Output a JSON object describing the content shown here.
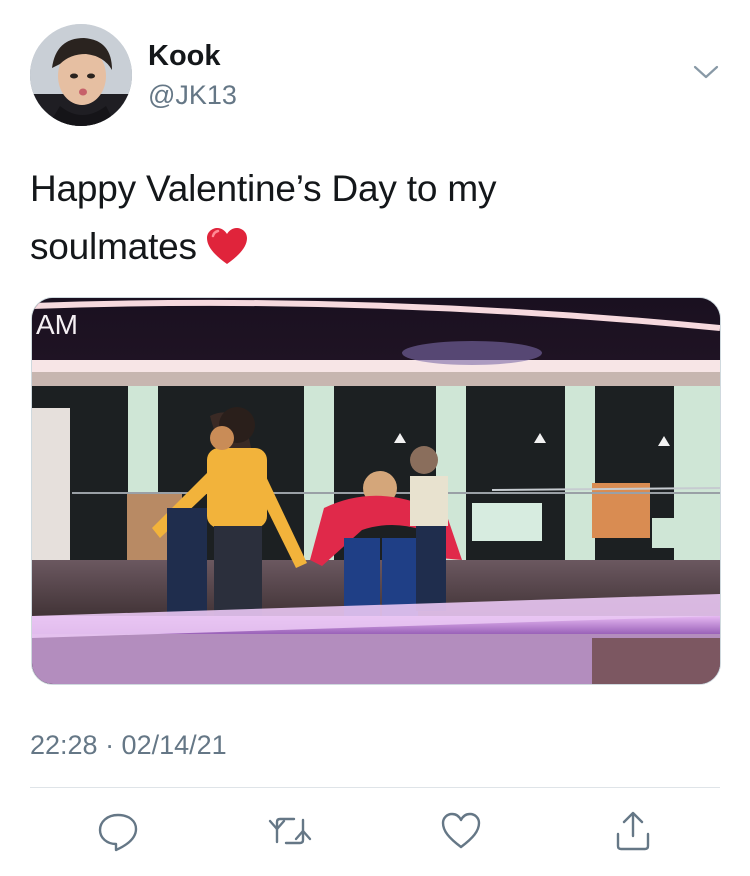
{
  "author": {
    "display_name": "Kook",
    "handle": "@JK13",
    "avatar_icon": "profile-photo"
  },
  "tweet": {
    "text": "Happy Valentine’s Day to my soulmates",
    "emoji": "red-heart",
    "media_overlay_text": "AM",
    "timestamp": "22:28 · 02/14/21"
  },
  "actions": [
    {
      "icon": "reply-icon"
    },
    {
      "icon": "retweet-icon"
    },
    {
      "icon": "like-icon"
    },
    {
      "icon": "share-icon"
    }
  ],
  "colors": {
    "text_primary": "#14171a",
    "text_secondary": "#657786",
    "icon": "#657786",
    "heart_emoji": "#e0243b"
  }
}
